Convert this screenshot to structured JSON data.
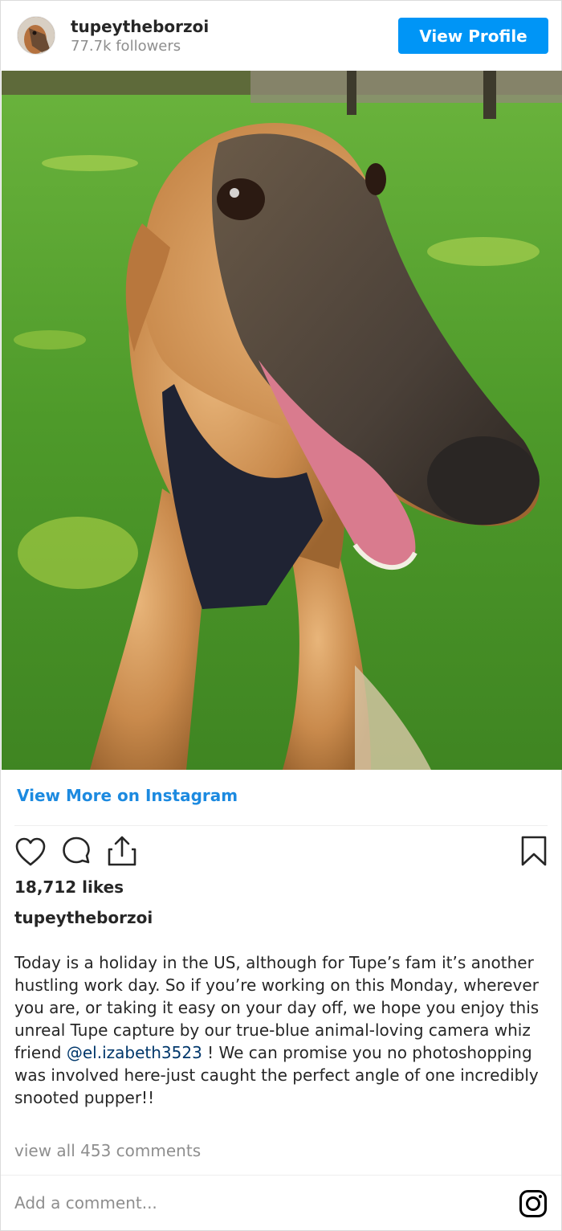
{
  "header": {
    "username": "tupeytheborzoi",
    "followers": "77.7k followers",
    "view_profile_label": "View Profile",
    "avatar_icon": "profile-avatar"
  },
  "photo": {
    "subject": "borzoi-dog-closeup",
    "colors": {
      "grass": "#4f9a2c",
      "fur": "#c98a4c",
      "snout": "#4a4038",
      "harness": "#1f2333",
      "tongue": "#d97b8e"
    }
  },
  "view_more_label": "View More on Instagram",
  "actions": {
    "like_icon": "heart-icon",
    "comment_icon": "comment-icon",
    "share_icon": "share-icon",
    "save_icon": "bookmark-icon"
  },
  "likes": "18,712 likes",
  "caption": {
    "username": "tupeytheborzoi",
    "text_before": "Today is a holiday in the US, although for Tupe’s fam it’s another hustling work day. So if you’re working on this Monday, wherever you are, or taking it easy on your day off, we hope you enjoy this unreal Tupe capture by our true-blue animal-loving camera whiz friend ",
    "mention": "@el.izabeth3523",
    "text_after": " ! We can promise you no photoshopping was involved here-just caught the perfect angle of one incredibly snooted pupper!!"
  },
  "view_comments": "view all 453 comments",
  "add_comment_placeholder": "Add a comment...",
  "brand": {
    "accent": "#0095f6",
    "link": "#1c8ae0",
    "icon": "instagram-logo-icon"
  }
}
